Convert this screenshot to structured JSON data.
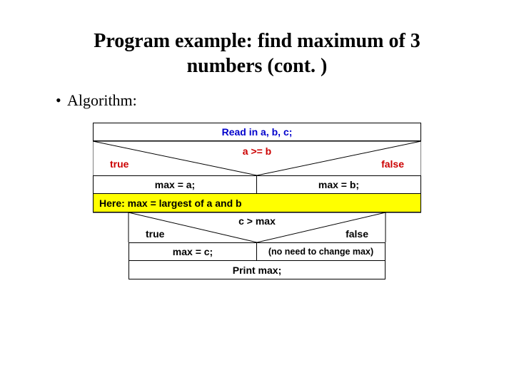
{
  "title_line1": "Program example: find maximum of 3",
  "title_line2": "numbers (cont. )",
  "bullet": "Algorithm:",
  "flow": {
    "read": "Read in a, b, c;",
    "tf1": {
      "true": "true",
      "false": "false",
      "cond": "a >= b"
    },
    "branch1": {
      "left": "max = a;",
      "right": "max = b;"
    },
    "note": "Here: max = largest of a and b",
    "tf2": {
      "true": "true",
      "false": "false",
      "cond": "c > max"
    },
    "branch2": {
      "left": "max = c;",
      "right": "(no need to change max)"
    },
    "print": "Print max;"
  }
}
